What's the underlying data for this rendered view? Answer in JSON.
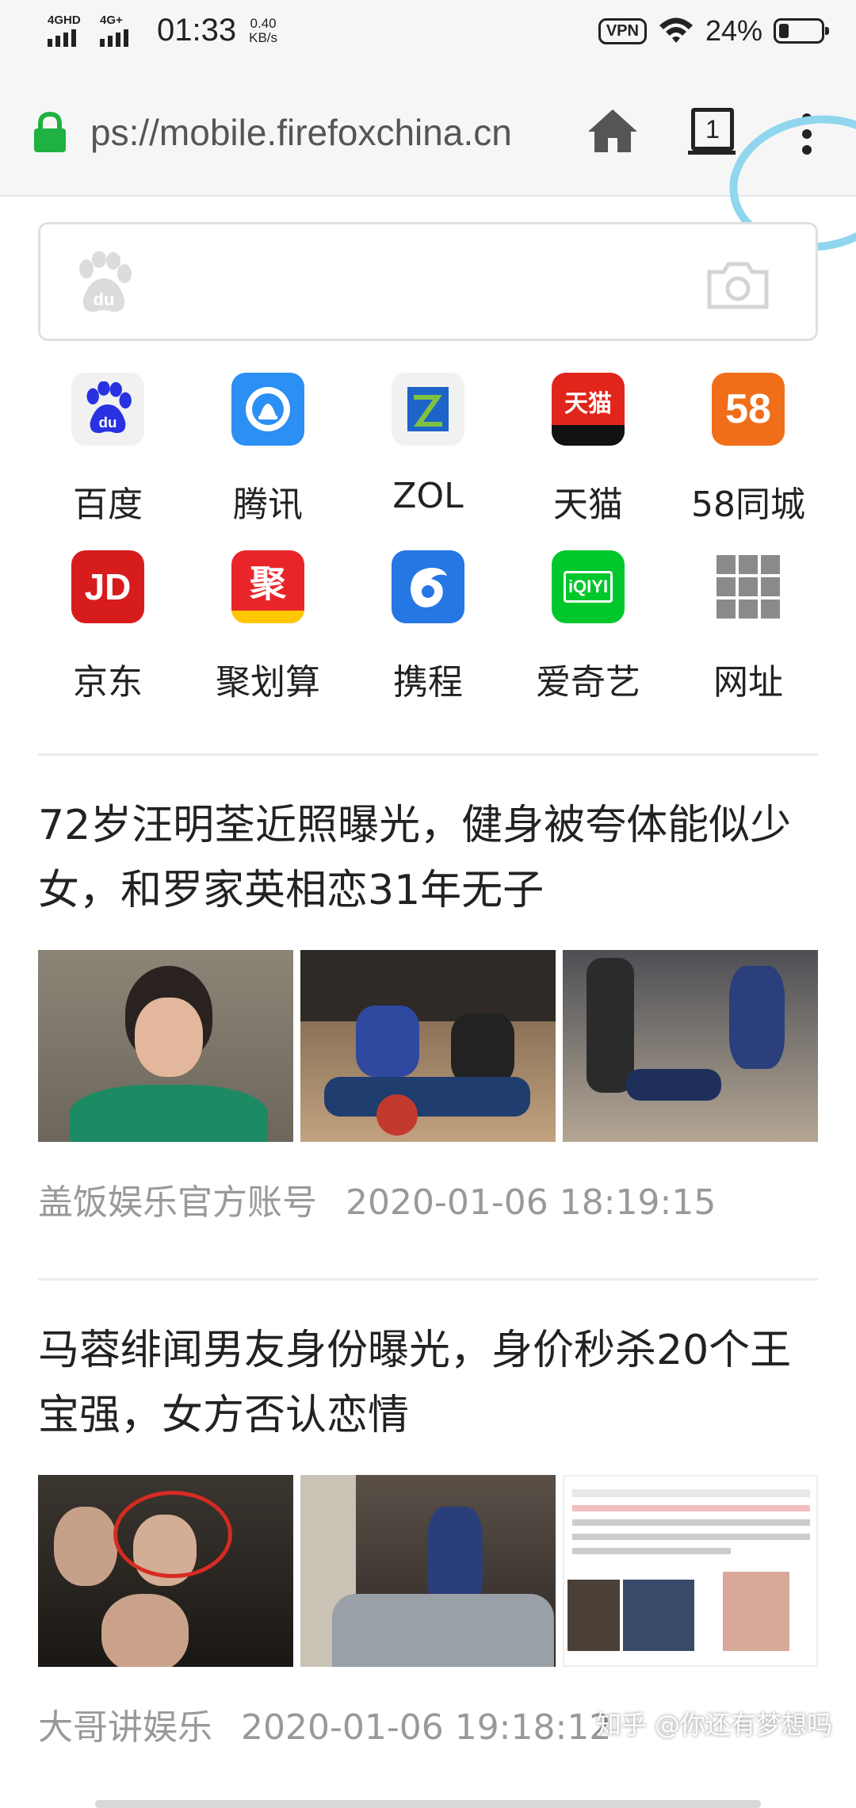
{
  "status_bar": {
    "net1": "4GHD",
    "net2": "4G+",
    "time": "01:33",
    "speed_value": "0.40",
    "speed_unit": "KB/s",
    "vpn": "VPN",
    "battery": "24%",
    "battery_level": 0.24
  },
  "url_bar": {
    "url": "ps://mobile.firefoxchina.cn",
    "tab_count": "1",
    "lock_icon": "lock-icon",
    "home_icon": "home-icon",
    "menu_icon": "overflow-menu-icon"
  },
  "search": {
    "logo_icon": "baidu-paw-icon",
    "camera_icon": "camera-icon"
  },
  "quick_links": [
    {
      "label": "百度",
      "icon": "baidu-icon"
    },
    {
      "label": "腾讯",
      "icon": "tencent-icon"
    },
    {
      "label": "ZOL",
      "icon": "zol-icon"
    },
    {
      "label": "天猫",
      "icon": "tmall-icon",
      "icon_text": "天猫"
    },
    {
      "label": "58同城",
      "icon": "58-icon",
      "icon_text": "58"
    },
    {
      "label": "京东",
      "icon": "jd-icon",
      "icon_text": "JD"
    },
    {
      "label": "聚划算",
      "icon": "juhuasuan-icon",
      "icon_text": "聚"
    },
    {
      "label": "携程",
      "icon": "ctrip-icon"
    },
    {
      "label": "爱奇艺",
      "icon": "iqiyi-icon",
      "icon_text": "iQIYI"
    },
    {
      "label": "网址",
      "icon": "grid-icon"
    }
  ],
  "news": [
    {
      "title": "72岁汪明荃近照曝光，健身被夸体能似少女，和罗家英相恋31年无子",
      "source": "盖饭娱乐官方账号",
      "time": "2020-01-06 18:19:15"
    },
    {
      "title": "马蓉绯闻男友身份曝光，身价秒杀20个王宝强，女方否认恋情",
      "source": "大哥讲娱乐",
      "time": "2020-01-06 19:18:12"
    }
  ],
  "watermark": "知乎 @你还有梦想吗",
  "colors": {
    "accent_lock": "#1fb141",
    "highlight_circle": "#8fd6ee",
    "meta_text": "#999999"
  }
}
